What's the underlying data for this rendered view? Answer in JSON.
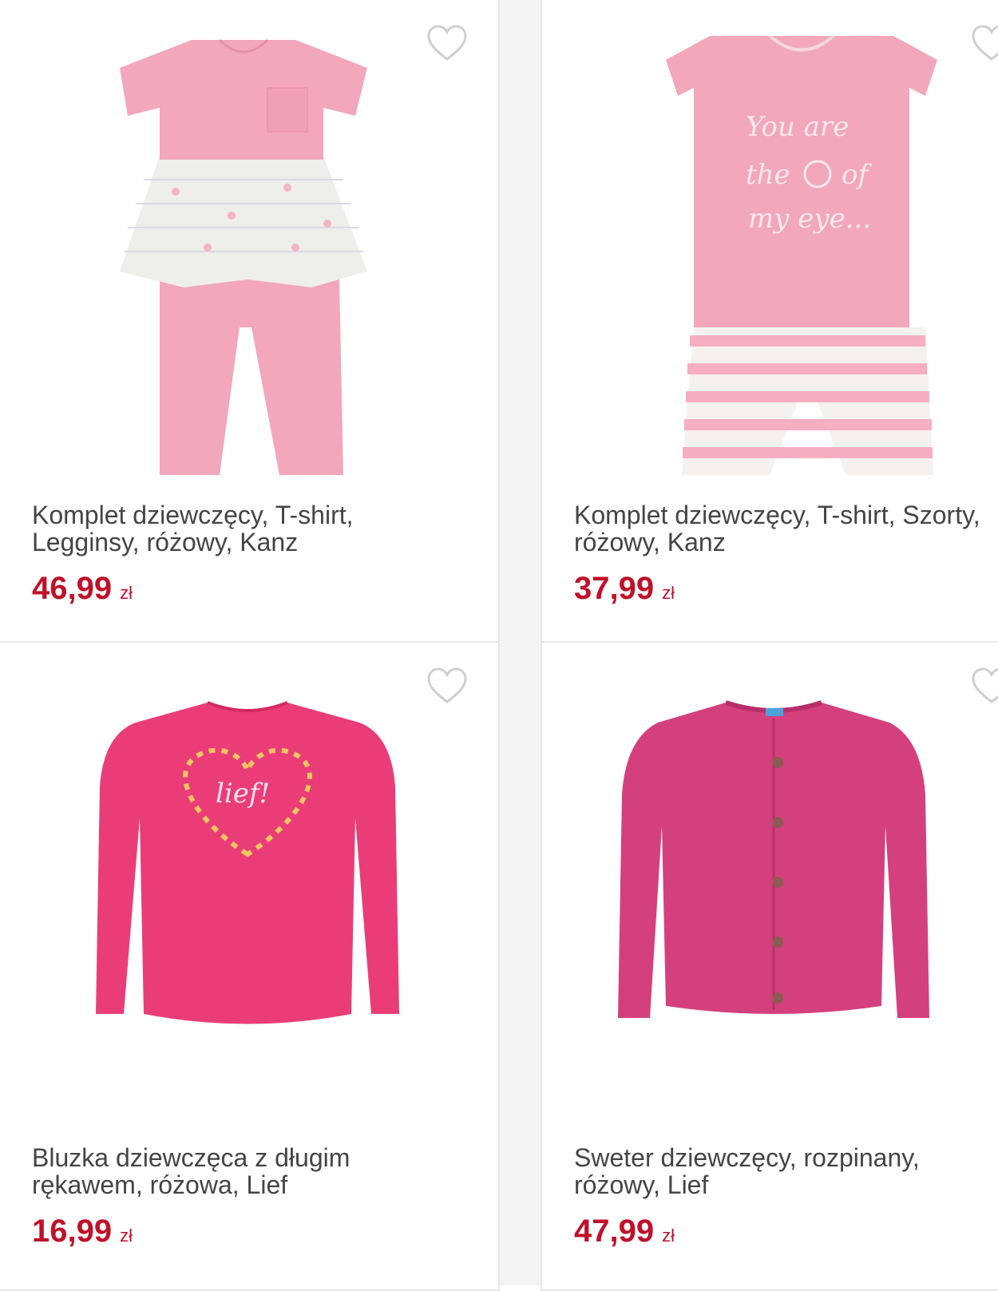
{
  "products": [
    {
      "name": "Komplet dziewczęcy, T-shirt,\nLegginsy, różowy, Kanz",
      "price": "46,99",
      "currency": "zł"
    },
    {
      "name": "Komplet dziewczęcy, T-shirt, Szorty,\nróżowy, Kanz",
      "price": "37,99",
      "currency": "zł"
    },
    {
      "name": "Bluzka dziewczęca z długim\nrękawem, różowa, Lief",
      "price": "16,99",
      "currency": "zł"
    },
    {
      "name": "Sweter dziewczęcy, rozpinany,\nróżowy, Lief",
      "price": "47,99",
      "currency": "zł"
    }
  ],
  "colors": {
    "price": "#c0112a",
    "text": "#444444",
    "border": "#e6e6e6",
    "heart": "#cfcfcf"
  },
  "icons": {
    "favorite": "heart-outline-icon"
  }
}
